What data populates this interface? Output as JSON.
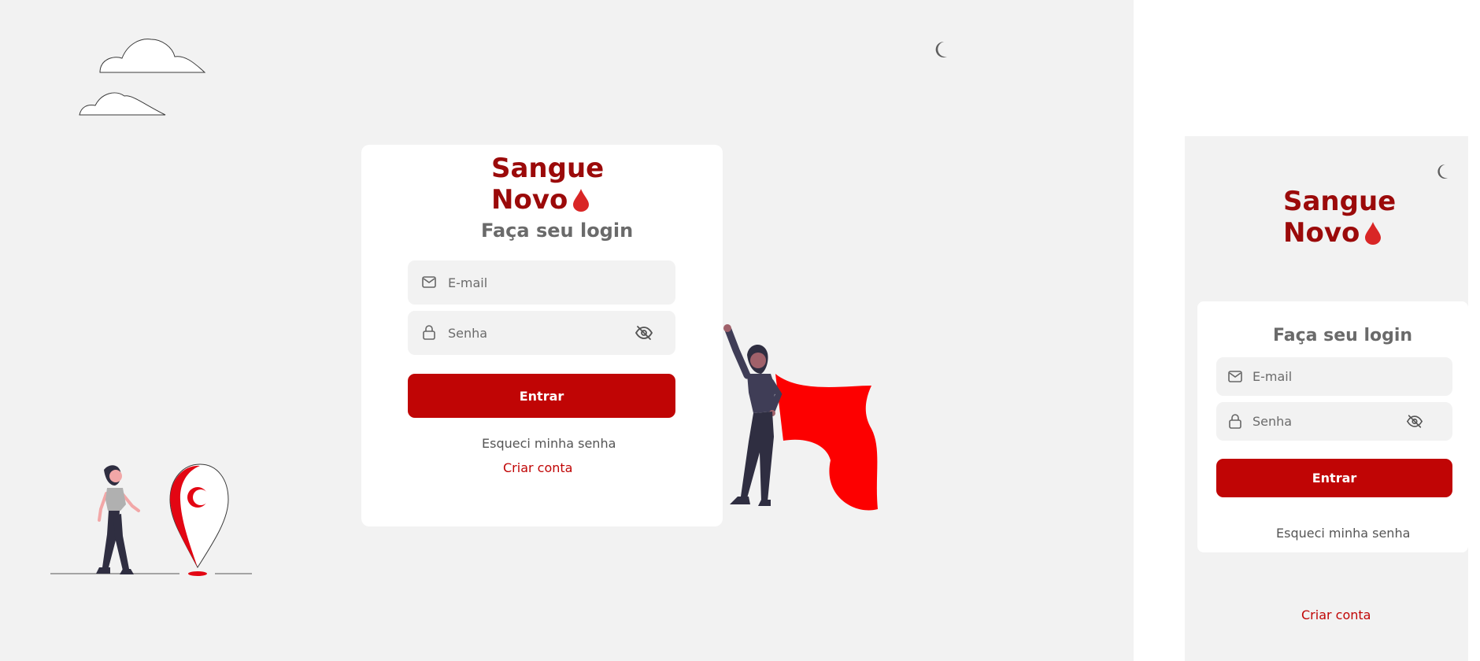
{
  "brand": {
    "line1": "Sangue",
    "line2": "Novo"
  },
  "login": {
    "title": "Faça seu login",
    "email_placeholder": "E-mail",
    "password_placeholder": "Senha",
    "submit_label": "Entrar",
    "forgot_label": "Esqueci minha senha",
    "create_label": "Criar conta"
  },
  "icons": {
    "theme_toggle": "moon-icon",
    "email": "mail-icon",
    "password": "lock-icon",
    "toggle_visibility": "eye-off-icon",
    "brand_mark": "blood-drop-icon"
  },
  "colors": {
    "brand": "#9b0a0a",
    "accent": "#c00505",
    "page_bg": "#f2f2f2",
    "card_bg": "#ffffff",
    "field_bg": "#f2f2f2",
    "muted_text": "#6a6a6a"
  }
}
